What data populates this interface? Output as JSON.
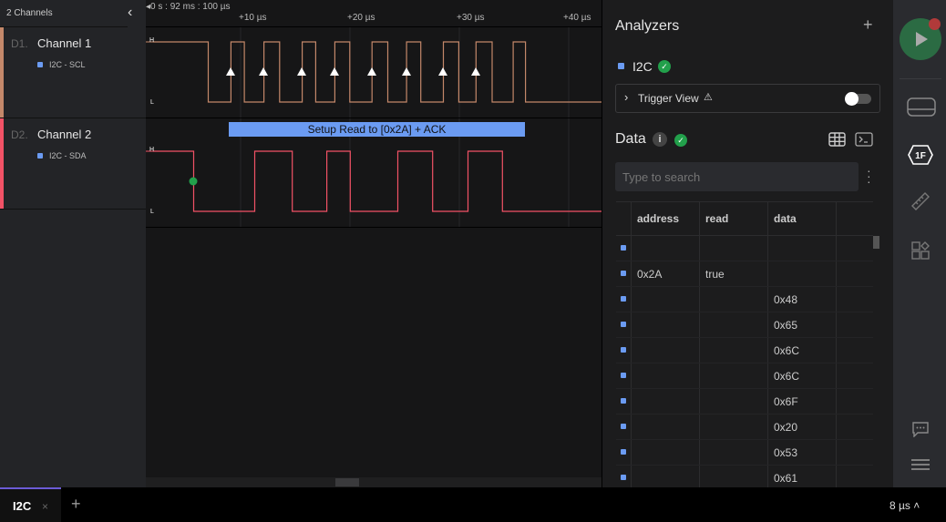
{
  "channels_header": {
    "title": "2 Channels"
  },
  "channels": [
    {
      "num": "D1.",
      "name": "Channel 1",
      "analyzer": "I2C - SCL",
      "color": "#c4886a"
    },
    {
      "num": "D2.",
      "name": "Channel 2",
      "analyzer": "I2C - SDA",
      "color": "#f25266"
    }
  ],
  "timeline": {
    "origin": "0 s : 92 ms : 100 µs",
    "ticks": [
      "+10 µs",
      "+20 µs",
      "+30 µs",
      "+40 µs"
    ]
  },
  "levels": {
    "high": "H",
    "low": "L"
  },
  "annotation": {
    "text": "Setup Read to [0x2A] + ACK",
    "color": "#6b9bf2"
  },
  "analyzers": {
    "title": "Analyzers",
    "add": "+",
    "items": [
      {
        "name": "I2C",
        "status": "ok"
      }
    ],
    "trigger_view": {
      "label": "Trigger View",
      "enabled": false
    }
  },
  "data": {
    "title": "Data",
    "search_placeholder": "Type to search",
    "columns": [
      "address",
      "read",
      "data"
    ],
    "rows": [
      {
        "address": "",
        "read": "",
        "data": ""
      },
      {
        "address": "0x2A",
        "read": "true",
        "data": ""
      },
      {
        "address": "",
        "read": "",
        "data": "0x48"
      },
      {
        "address": "",
        "read": "",
        "data": "0x65"
      },
      {
        "address": "",
        "read": "",
        "data": "0x6C"
      },
      {
        "address": "",
        "read": "",
        "data": "0x6C"
      },
      {
        "address": "",
        "read": "",
        "data": "0x6F"
      },
      {
        "address": "",
        "read": "",
        "data": "0x20"
      },
      {
        "address": "",
        "read": "",
        "data": "0x53"
      },
      {
        "address": "",
        "read": "",
        "data": "0x61"
      }
    ]
  },
  "bottom": {
    "tab": "I2C",
    "add": "+",
    "zoom": "8 µs"
  },
  "colors": {
    "accent": "#6b9bf2",
    "ok": "#22a04b",
    "play": "#2b6b43",
    "record": "#b13a3a"
  }
}
